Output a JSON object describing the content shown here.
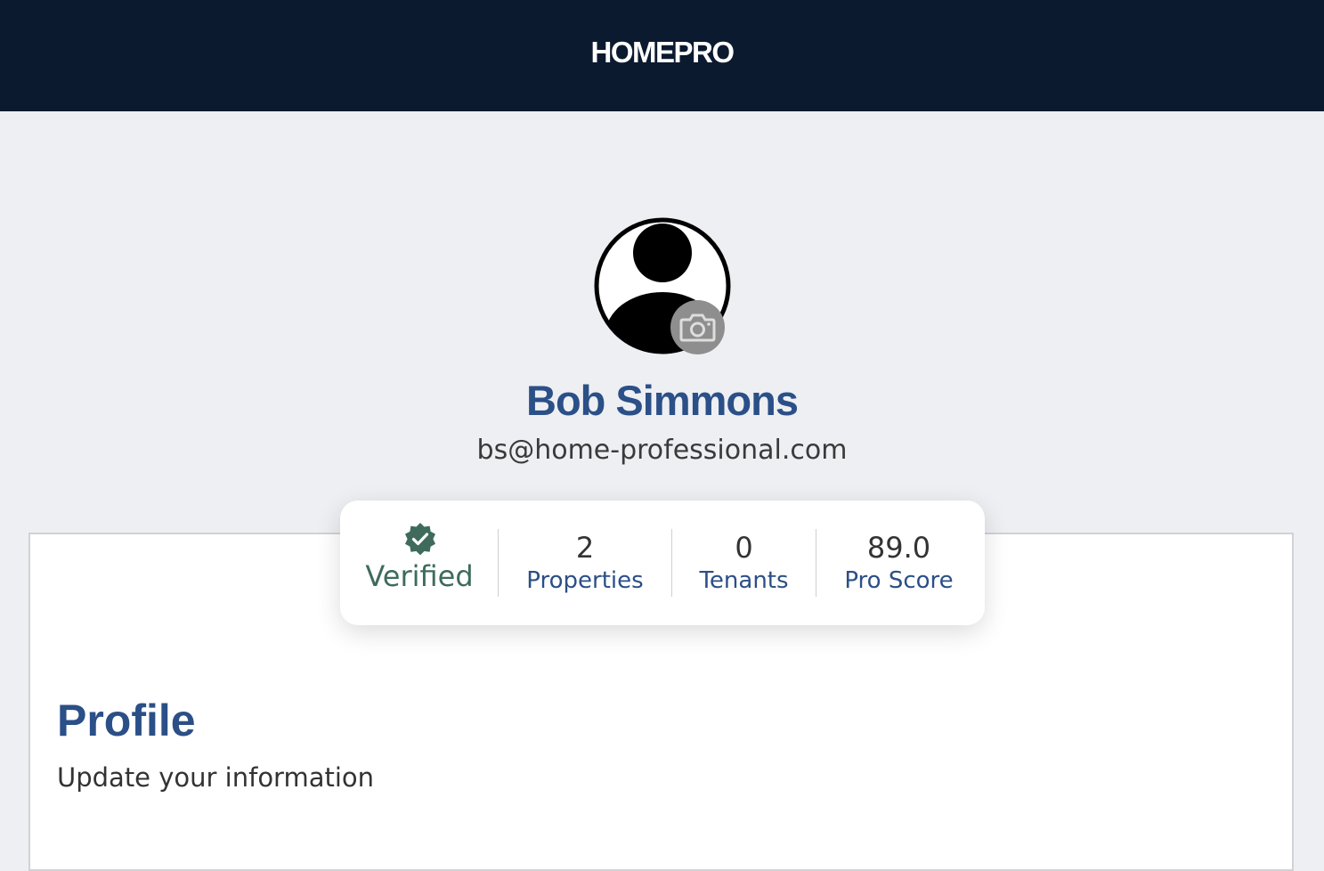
{
  "header": {
    "brand": "HOMEPRO",
    "background": "#0b1a2f"
  },
  "user": {
    "avatar_icon": "user-avatar-icon",
    "camera_icon": "camera-icon",
    "name": "Bob Simmons",
    "email": "bs@home-professional.com"
  },
  "stats": {
    "verified": {
      "icon": "verified-check-badge-icon",
      "label": "Verified",
      "color": "#3e6b5c"
    },
    "items": [
      {
        "value": "2",
        "label": "Properties"
      },
      {
        "value": "0",
        "label": "Tenants"
      },
      {
        "value": "89.0",
        "label": "Pro Score"
      }
    ]
  },
  "profile": {
    "title": "Profile",
    "subtitle": "Update your information"
  },
  "colors": {
    "accent": "#2b4f87",
    "page_background": "#edeff3"
  }
}
